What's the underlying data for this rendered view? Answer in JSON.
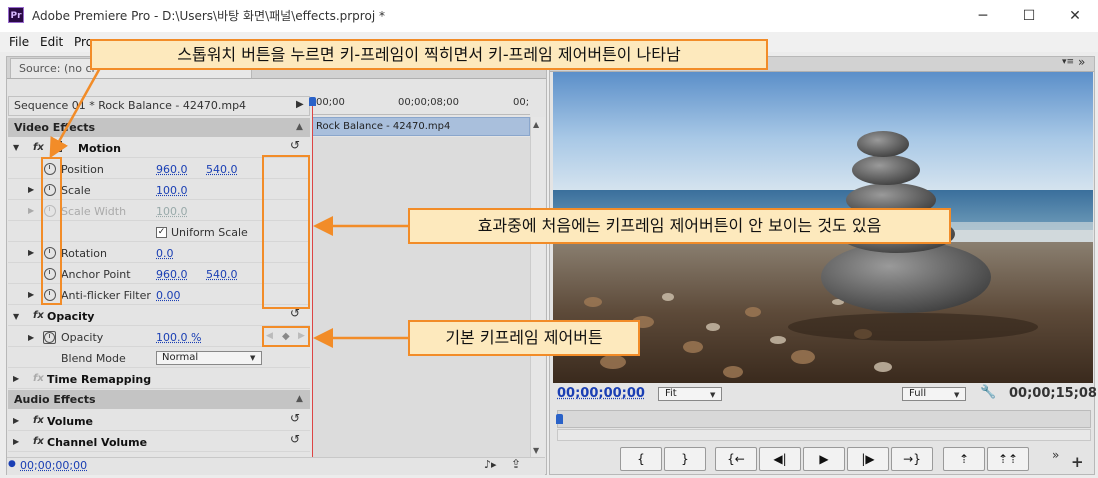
{
  "window": {
    "app_icon_text": "Pr",
    "title": "Adobe Premiere Pro - D:\\Users\\바탕 화면\\패널\\effects.prproj *",
    "minimize_glyph": "─",
    "maximize_glyph": "☐",
    "close_glyph": "✕"
  },
  "menu": [
    "File",
    "Edit",
    "Pro"
  ],
  "left_panel": {
    "source_tab_label": "Source: (no cl",
    "sequence_label": "Sequence 01 * Rock Balance - 42470.mp4",
    "video_effects_header": "Video Effects",
    "audio_effects_header": "Audio Effects",
    "timeline": {
      "ruler_labels": [
        "00;00",
        "00;00;08;00",
        "00;"
      ],
      "clip_label": "Rock Balance - 42470.mp4"
    },
    "effects": {
      "motion": {
        "name": "Motion",
        "properties": {
          "position": {
            "label": "Position",
            "x": "960.0",
            "y": "540.0"
          },
          "scale": {
            "label": "Scale",
            "value": "100.0"
          },
          "scale_width": {
            "label": "Scale Width",
            "value": "100.0"
          },
          "uniform_scale": {
            "label": "Uniform Scale",
            "checked": true
          },
          "rotation": {
            "label": "Rotation",
            "value": "0.0"
          },
          "anchor_point": {
            "label": "Anchor Point",
            "x": "960.0",
            "y": "540.0"
          },
          "anti_flicker": {
            "label": "Anti-flicker Filter",
            "value": "0.00"
          }
        }
      },
      "opacity": {
        "name": "Opacity",
        "properties": {
          "opacity": {
            "label": "Opacity",
            "value": "100.0 %"
          },
          "blend_mode": {
            "label": "Blend Mode",
            "value": "Normal"
          }
        }
      },
      "time_remapping": {
        "name": "Time Remapping"
      },
      "volume": {
        "name": "Volume"
      },
      "channel_volume": {
        "name": "Channel Volume"
      }
    },
    "current_time": "00;00;00;00"
  },
  "program_monitor": {
    "timecode": "00;00;00;00",
    "zoom": "Fit",
    "resolution": "Full",
    "duration": "00;00;15;08",
    "transport": {
      "mark_in": "{",
      "mark_out": "}",
      "go_to_in": "{←",
      "step_back": "◀|",
      "play": "▶",
      "step_forward": "|▶",
      "go_to_out": "→}",
      "lift": "⇡",
      "extract": "⇡⇡",
      "more": "»",
      "add": "+"
    }
  },
  "annotations": {
    "stopwatch_note": "스톱워치 버튼을 누르면 키-프레임이 찍히면서  키-프레임 제어버튼이 나타남",
    "hidden_note": "효과중에 처음에는 키프레임 제어버튼이 안 보이는 것도 있음",
    "basic_note": "기본 키프레임 제어버튼"
  },
  "colors": {
    "accent_blue": "#1a3fb4",
    "annotation_orange": "#f28c28",
    "annotation_fill": "#fde9bd",
    "clip_blue": "#a9bfdc",
    "playhead_red": "#dd4444"
  },
  "icons": {
    "stopwatch": "stopwatch-icon",
    "reset": "reset-icon",
    "fx": "fx-badge-icon",
    "motion_transform": "transform-box-icon",
    "twirl": "twirl-triangle-icon",
    "wrench": "wrench-icon"
  }
}
